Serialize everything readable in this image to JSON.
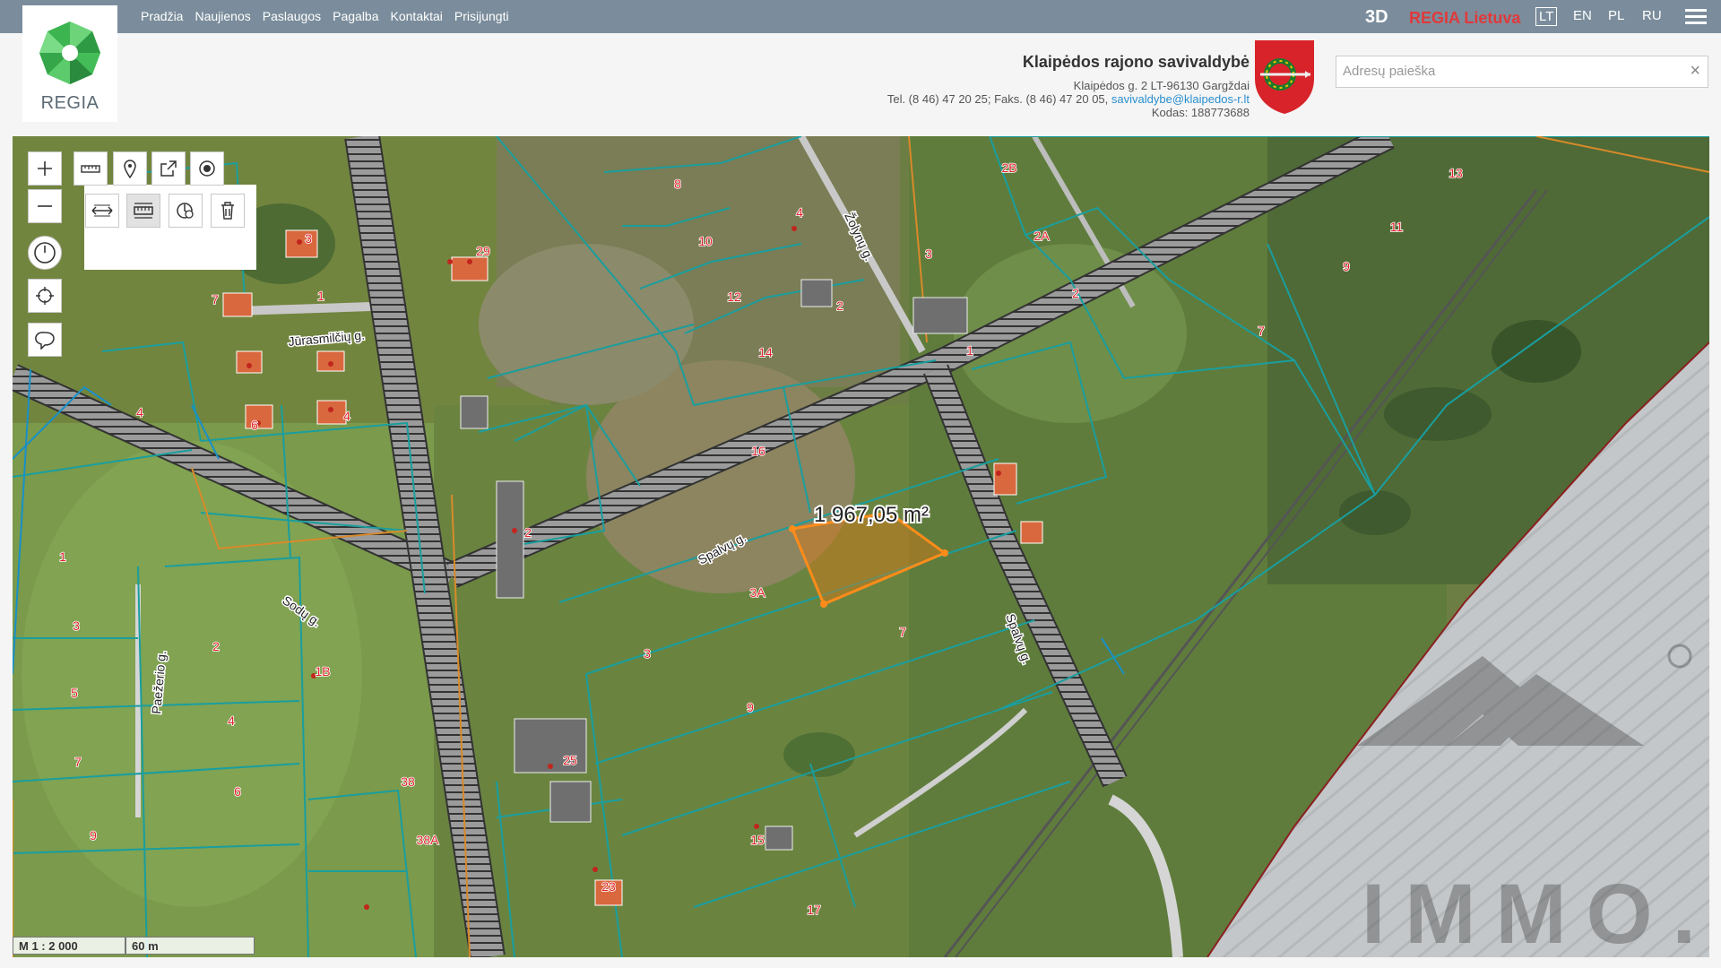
{
  "nav": {
    "items": [
      "Pradžia",
      "Naujienos",
      "Paslaugos",
      "Pagalba",
      "Kontaktai",
      "Prisijungti"
    ]
  },
  "brand": {
    "logo_text": "REGIA"
  },
  "topright": {
    "btn_3d": "3D",
    "regia_lietuva": "REGIA Lietuva",
    "languages": [
      "LT",
      "EN",
      "PL",
      "RU"
    ],
    "active_language": "LT"
  },
  "municipality": {
    "name": "Klaipėdos rajono savivaldybė",
    "address": "Klaipėdos g. 2 LT-96130 Gargždai",
    "phone_fax": "Tel. (8 46) 47 20 25; Faks. (8 46) 47 20 05, ",
    "email": "savivaldybe@klaipedos-r.lt",
    "code": "Kodas: 188773688"
  },
  "search": {
    "placeholder": "Adresų paieška",
    "value": "",
    "clear_icon": "×"
  },
  "map": {
    "measurement": "1 967,05 m²",
    "scale": "M 1 : 2 000",
    "scale_length": "60 m",
    "watermark": "IMMO.LT",
    "streets": [
      "Jūrasmilčių g.",
      "Sodų g.",
      "Spalvų g.",
      "Spalvų g.",
      "Žolynų g.",
      "Paežerio g."
    ],
    "parcel_labels": [
      "8",
      "10",
      "12",
      "14",
      "16",
      "4",
      "2",
      "1",
      "3",
      "2B",
      "2A",
      "2",
      "13",
      "11",
      "9",
      "7",
      "29",
      "3",
      "7",
      "1",
      "4",
      "4",
      "6",
      "3A",
      "3",
      "7",
      "9",
      "15",
      "17",
      "25",
      "38",
      "38A",
      "23",
      "1",
      "3",
      "5",
      "7",
      "9",
      "2",
      "4",
      "6",
      "1B",
      "2"
    ]
  },
  "colors": {
    "topbar": "#7b8d9c",
    "accent_red": "#e0393b",
    "parcel_line": "#1a9e9e",
    "measure": "#ff8c1a"
  }
}
